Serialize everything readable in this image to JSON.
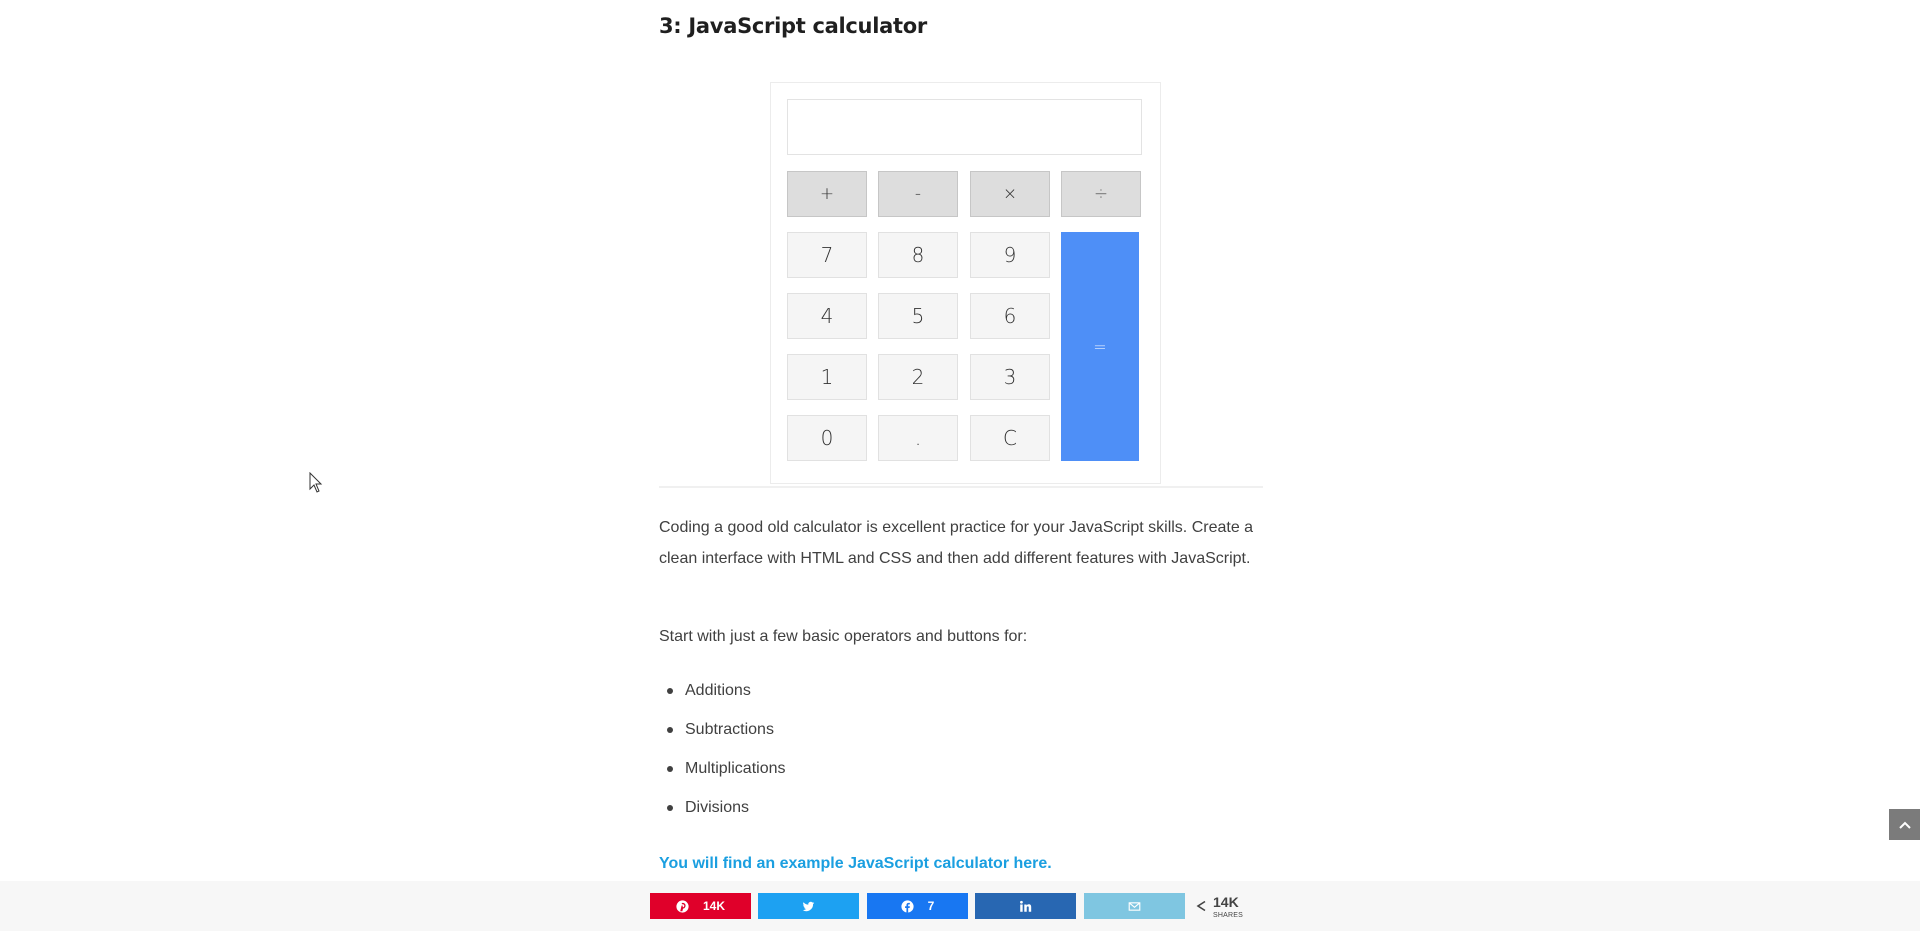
{
  "article": {
    "heading": "3: JavaScript calculator",
    "paragraph1": "Coding a good old calculator is excellent practice for your JavaScript skills. Create a clean interface with HTML and CSS and then add different features with JavaScript.",
    "paragraph2": "Start with just a few basic operators and buttons for:",
    "bullets": [
      "Additions",
      "Subtractions",
      "Multiplications",
      "Divisions"
    ],
    "link_text": "You will find an example JavaScript calculator here."
  },
  "calculator": {
    "display_value": "",
    "operators": [
      "+",
      "-",
      "×",
      "÷"
    ],
    "keys": [
      "7",
      "8",
      "9",
      "4",
      "5",
      "6",
      "1",
      "2",
      "3",
      "0",
      ".",
      "C"
    ],
    "equals": "="
  },
  "share_bar": {
    "pinterest_count": "14K",
    "facebook_count": "7",
    "total_count": "14K",
    "total_label": "SHARES",
    "colors": {
      "pinterest": "#e0002a",
      "twitter": "#1da1f2",
      "facebook": "#1877f2",
      "linkedin": "#2867b2",
      "email": "#7fc6e1"
    },
    "icons": [
      "pinterest-icon",
      "twitter-icon",
      "facebook-icon",
      "linkedin-icon",
      "email-icon",
      "share-icon"
    ]
  },
  "colors": {
    "equals_key": "#4e8ff7",
    "link": "#1b9fe0",
    "scroll_top": "#7b7b7b"
  }
}
